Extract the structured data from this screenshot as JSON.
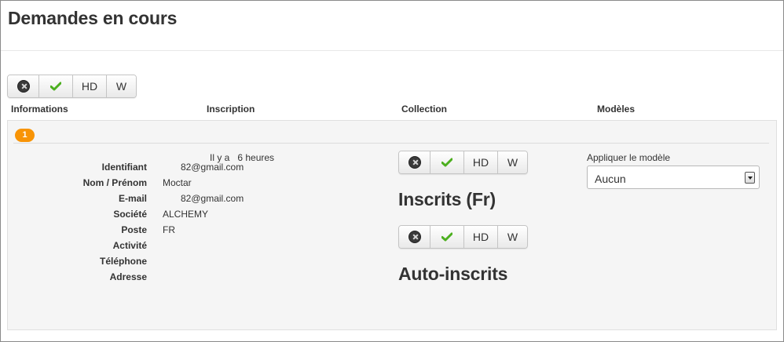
{
  "page": {
    "title": "Demandes en cours"
  },
  "toolbar": {
    "buttons": [
      {
        "icon": "cancel-icon",
        "label": ""
      },
      {
        "icon": "check-icon",
        "label": ""
      },
      {
        "label": "HD"
      },
      {
        "label": "W"
      }
    ]
  },
  "columns": {
    "informations": "Informations",
    "inscription": "Inscription",
    "collection": "Collection",
    "modeles": "Modèles"
  },
  "request": {
    "badge": "1",
    "since_prefix": "Il y a",
    "since_value": "6 heures",
    "fields": [
      {
        "label": "Identifiant",
        "value": "82@gmail.com"
      },
      {
        "label": "Nom / Prénom",
        "value": "Moctar"
      },
      {
        "label": "E-mail",
        "value": "82@gmail.com"
      },
      {
        "label": "Société",
        "value": "ALCHEMY"
      },
      {
        "label": "Poste",
        "value": "FR"
      },
      {
        "label": "Activité",
        "value": ""
      },
      {
        "label": "Téléphone",
        "value": ""
      },
      {
        "label": "Adresse",
        "value": ""
      }
    ],
    "collections": [
      {
        "title": "Inscrits (Fr)",
        "buttons": [
          "HD",
          "W"
        ]
      },
      {
        "title": "Auto-inscrits",
        "buttons": [
          "HD",
          "W"
        ]
      }
    ],
    "model": {
      "label": "Appliquer le modèle",
      "selected": "Aucun"
    }
  },
  "colors": {
    "badge": "#f89406",
    "check": "#4caf1f",
    "panel": "#f5f5f5"
  }
}
